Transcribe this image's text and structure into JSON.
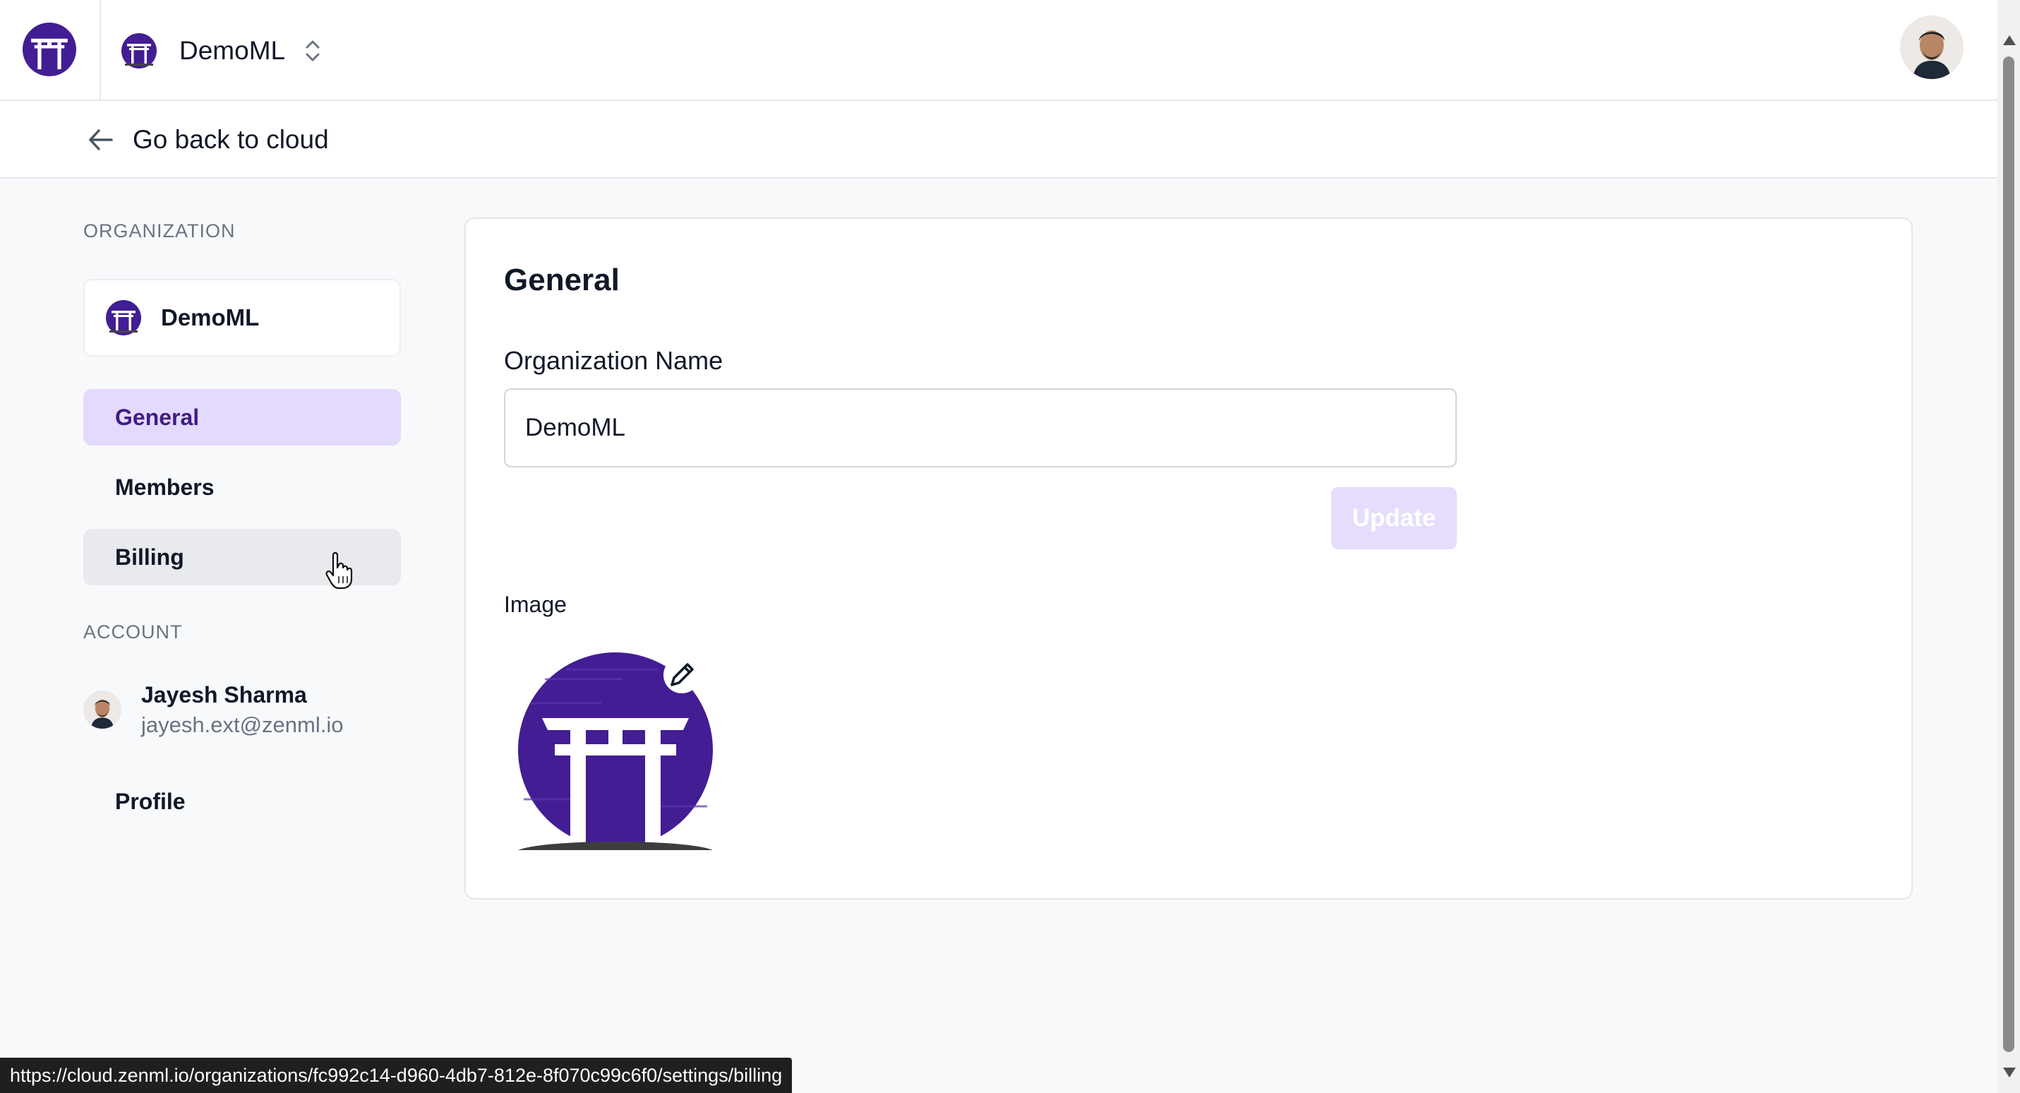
{
  "header": {
    "org_name": "DemoML",
    "logo_icon": "zenml-torii-logo",
    "switcher_icon": "chevron-up-down-icon",
    "user_avatar": "user-avatar"
  },
  "back_link": {
    "label": "Go back to cloud",
    "icon": "arrow-left-icon"
  },
  "sidebar": {
    "organization_label": "ORGANIZATION",
    "org_card_name": "DemoML",
    "items": [
      {
        "label": "General",
        "active": true
      },
      {
        "label": "Members",
        "active": false
      },
      {
        "label": "Billing",
        "active": false,
        "hovered": true
      }
    ],
    "account_label": "ACCOUNT",
    "account": {
      "name": "Jayesh Sharma",
      "email": "jayesh.ext@zenml.io"
    },
    "account_items": [
      {
        "label": "Profile"
      }
    ]
  },
  "main": {
    "title": "General",
    "org_name_label": "Organization Name",
    "org_name_value": "DemoML",
    "update_label": "Update",
    "image_label": "Image",
    "edit_icon": "pencil-icon"
  },
  "status_bar": {
    "url": "https://cloud.zenml.io/organizations/fc992c14-d960-4db7-812e-8f070c99c6f0/settings/billing"
  },
  "colors": {
    "brand_purple": "#431d93",
    "active_nav_bg": "#e4dafd",
    "active_nav_text": "#3f1d86",
    "update_disabled_bg": "#e6ddfd"
  }
}
